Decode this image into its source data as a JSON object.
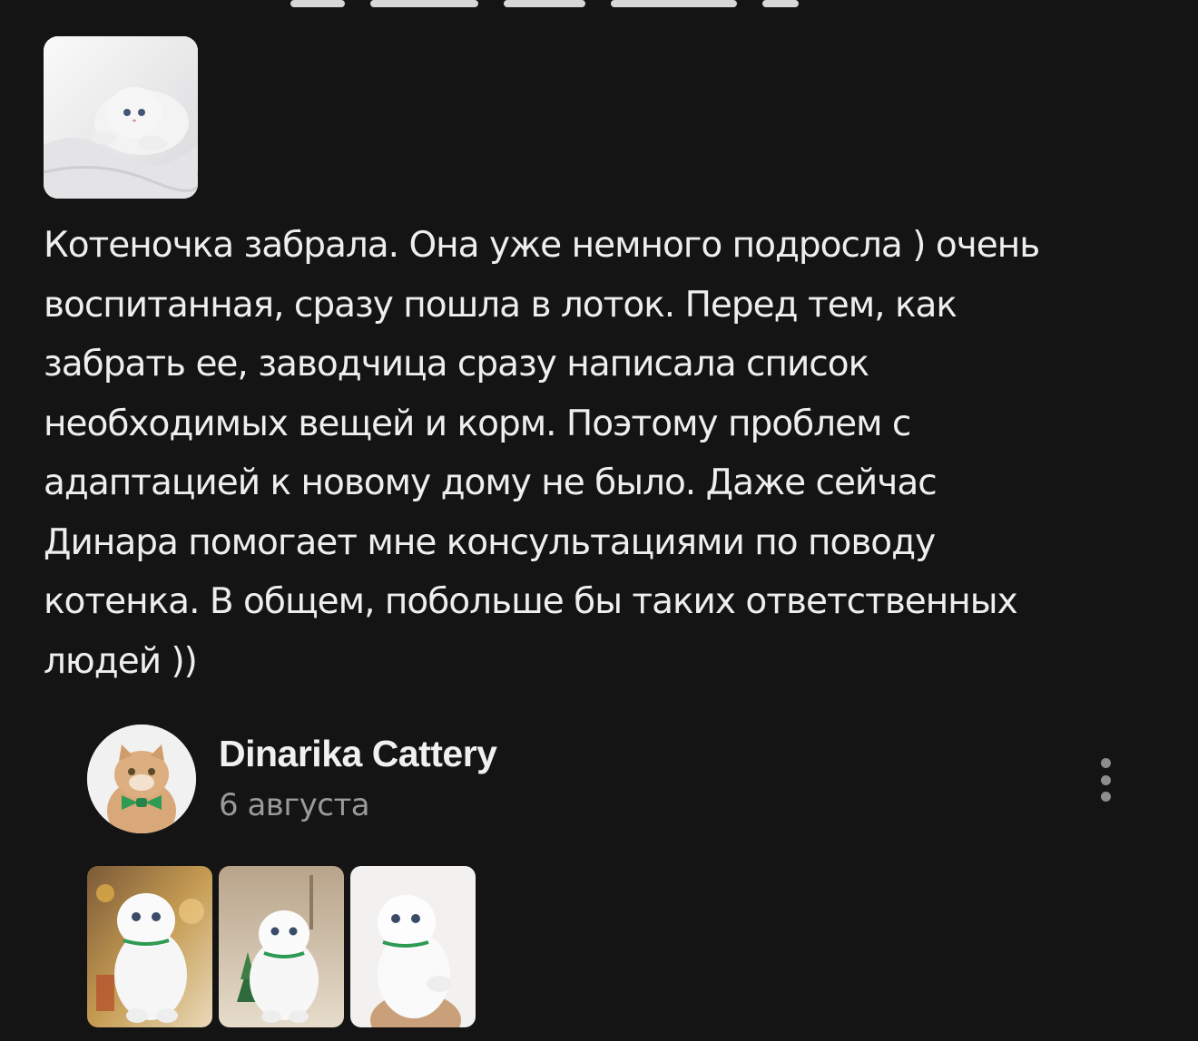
{
  "review": {
    "photo_alt": "white kitten on blanket",
    "text": "Котеночка забрала. Она уже немного подросла ) очень\nвоспитанная, сразу пошла в лоток. Перед тем, как\nзабрать ее, заводчица сразу написала список\nнеобходимых вещей и корм. Поэтому проблем с\nадаптацией к новому дому не было. Даже сейчас\nДинара помогает мне консультациями по поводу\nкотенка. В общем, побольше бы таких ответственных\nлюдей ))"
  },
  "reply": {
    "author": "Dinarika Cattery",
    "date": "6 августа",
    "more_icon": "more-vertical-icon",
    "gallery": [
      {
        "alt": "white kitten with green collar, festive background"
      },
      {
        "alt": "white kitten with green collar near christmas tree"
      },
      {
        "alt": "white kitten with green collar held in hand"
      }
    ]
  },
  "colors": {
    "background": "#141414",
    "text": "#eeeeee",
    "muted": "#9a9a9a",
    "collar_green": "#2e9a52"
  }
}
